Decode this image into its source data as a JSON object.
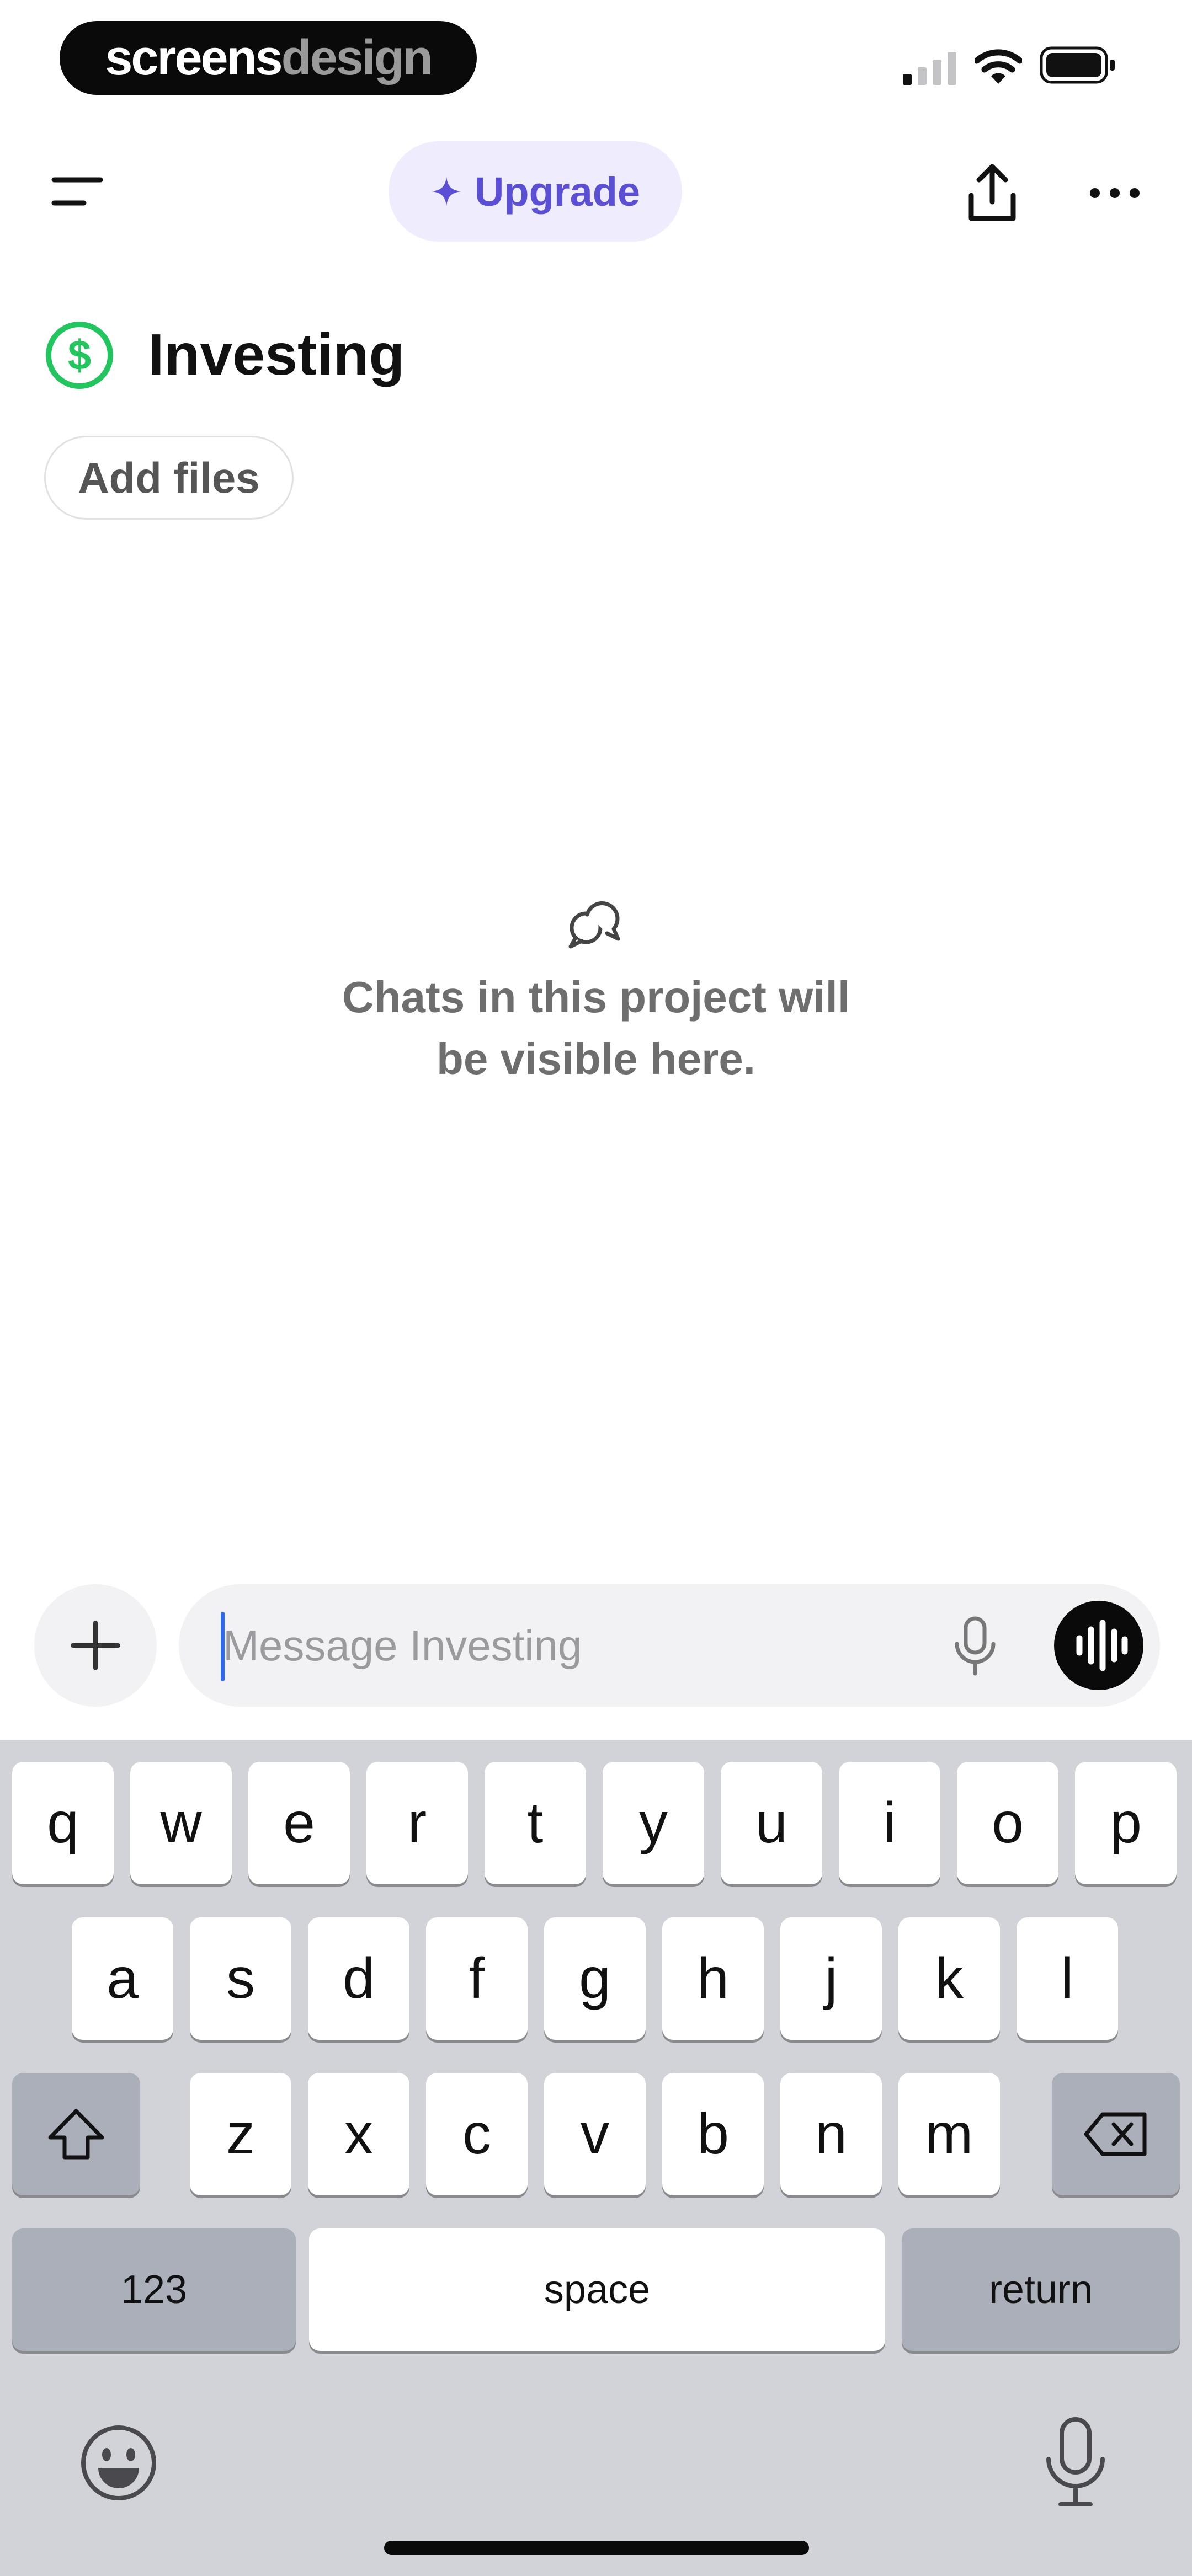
{
  "status_bar": {
    "badge_part1": "screens",
    "badge_part2": "design"
  },
  "header": {
    "upgrade_label": "Upgrade",
    "icons": [
      "menu-icon",
      "sparkle-icon",
      "share-icon",
      "more-icon"
    ]
  },
  "project": {
    "title": "Investing",
    "icon": "dollar-circle-icon",
    "icon_color": "#22c55e",
    "add_files_label": "Add files"
  },
  "empty_state": {
    "icon": "chat-bubbles-icon",
    "line1": "Chats in this project will",
    "line2": "be visible here."
  },
  "composer": {
    "placeholder": "Message Investing",
    "value": "",
    "icons": [
      "plus-icon",
      "microphone-icon",
      "voice-waveform-icon"
    ]
  },
  "keyboard": {
    "row1": [
      "q",
      "w",
      "e",
      "r",
      "t",
      "y",
      "u",
      "i",
      "o",
      "p"
    ],
    "row2": [
      "a",
      "s",
      "d",
      "f",
      "g",
      "h",
      "j",
      "k",
      "l"
    ],
    "row3": [
      "z",
      "x",
      "c",
      "v",
      "b",
      "n",
      "m"
    ],
    "numbers_label": "123",
    "space_label": "space",
    "return_label": "return",
    "icons": [
      "shift-icon",
      "backspace-icon",
      "emoji-icon",
      "dictation-icon"
    ]
  },
  "colors": {
    "accent": "#5b4fd6",
    "upgrade_bg": "#efedfd",
    "caret": "#2f6bf0",
    "keyboard_bg": "#d1d3d9"
  }
}
